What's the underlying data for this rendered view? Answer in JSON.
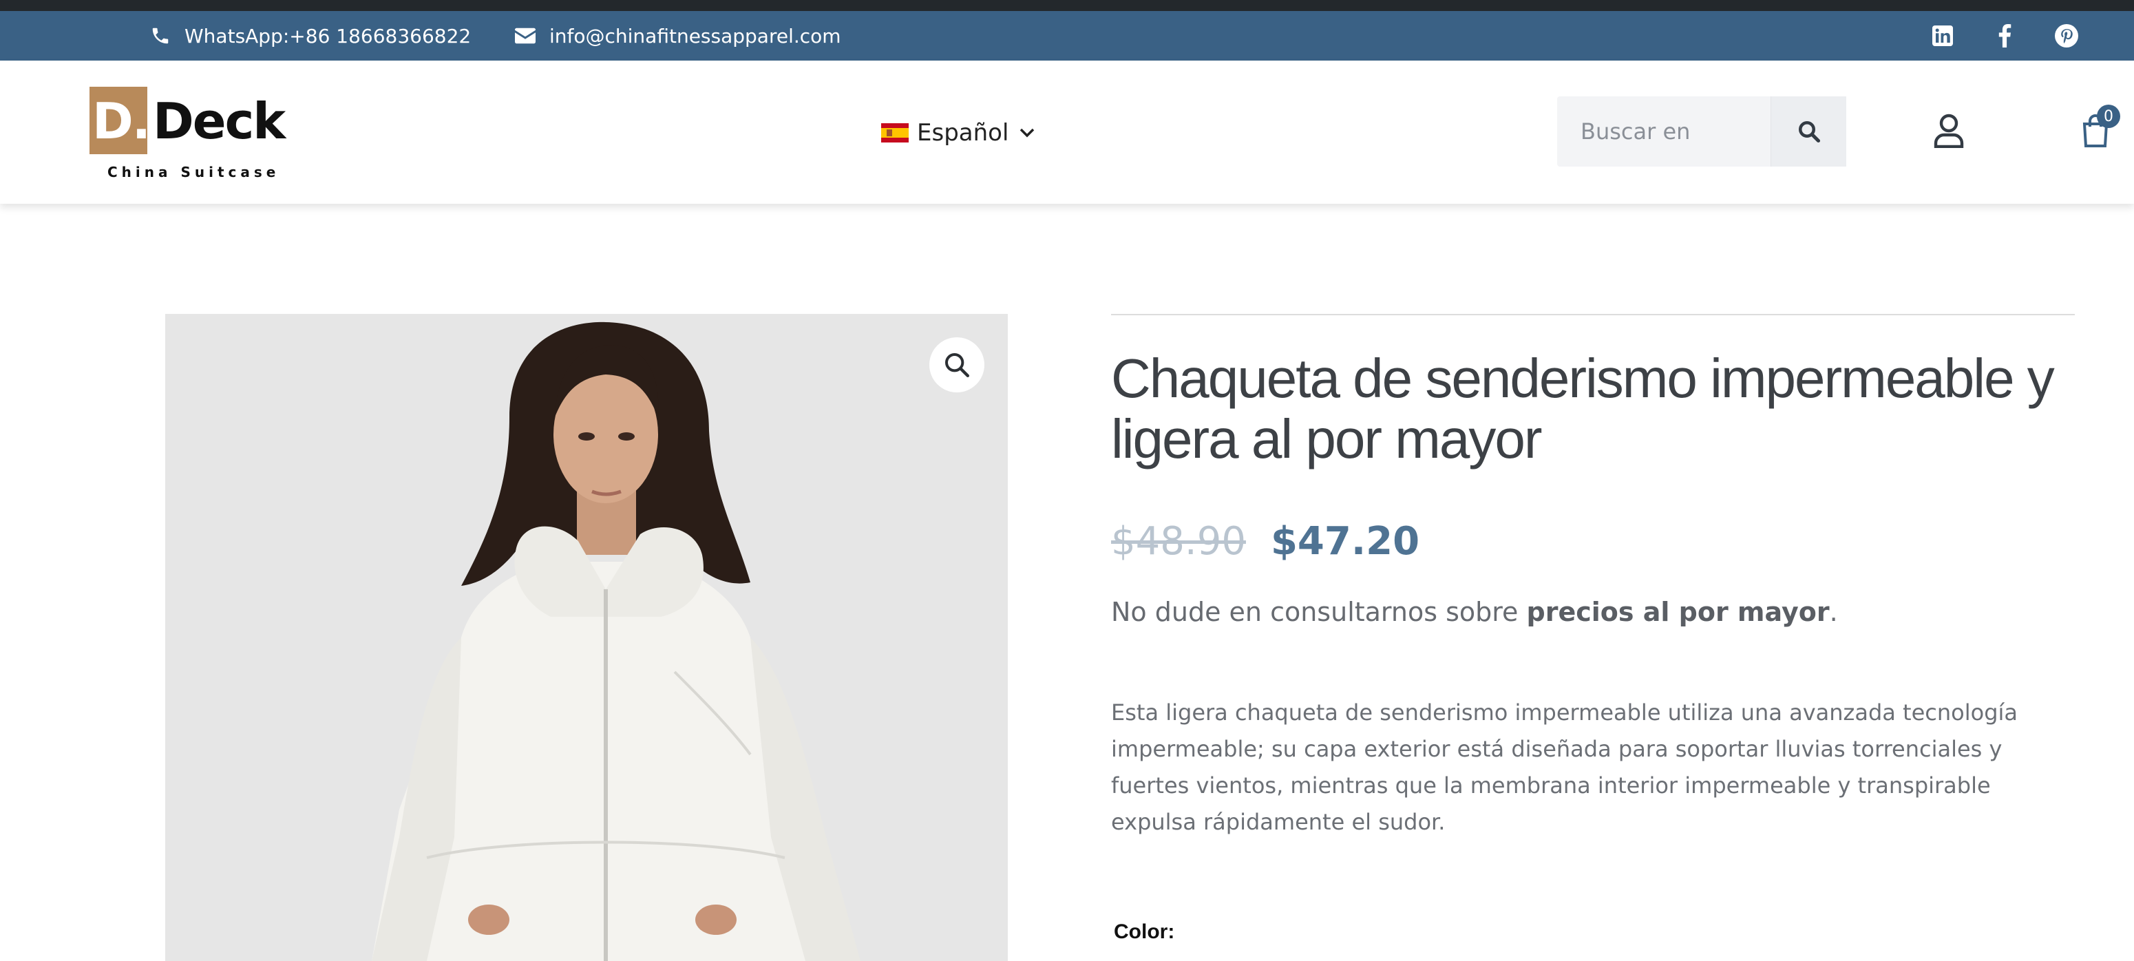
{
  "topbar": {
    "whatsapp": "WhatsApp:+86 18668366822",
    "email": "info@chinafitnessapparel.com",
    "social_icons": [
      "linkedin-icon",
      "facebook-icon",
      "pinterest-icon"
    ],
    "background": "#3a6185"
  },
  "header": {
    "logo": {
      "mark": "D.",
      "name": "Deck",
      "tagline": "China Suitcase",
      "accent": "#b88a5a"
    },
    "language": {
      "selected": "Español",
      "flag": "spain-flag-icon"
    },
    "search": {
      "placeholder": "Buscar en"
    },
    "cart_count": "0"
  },
  "product": {
    "title": "Chaqueta de senderismo impermeable y ligera al por mayor",
    "price_old": "$48.90",
    "price_new": "$47.20",
    "note_prefix": "No dude en consultarnos sobre ",
    "note_bold": "precios al por mayor",
    "note_suffix": ".",
    "description": "Esta ligera chaqueta de senderismo impermeable utiliza una avanzada tecnología impermeable; su capa exterior está diseñada para soportar lluvias torrenciales y fuertes vientos, mientras que la membrana interior impermeable y transpirable expulsa rápidamente el sudor.",
    "color_label": "Color:",
    "price_color": "#4f7393"
  }
}
